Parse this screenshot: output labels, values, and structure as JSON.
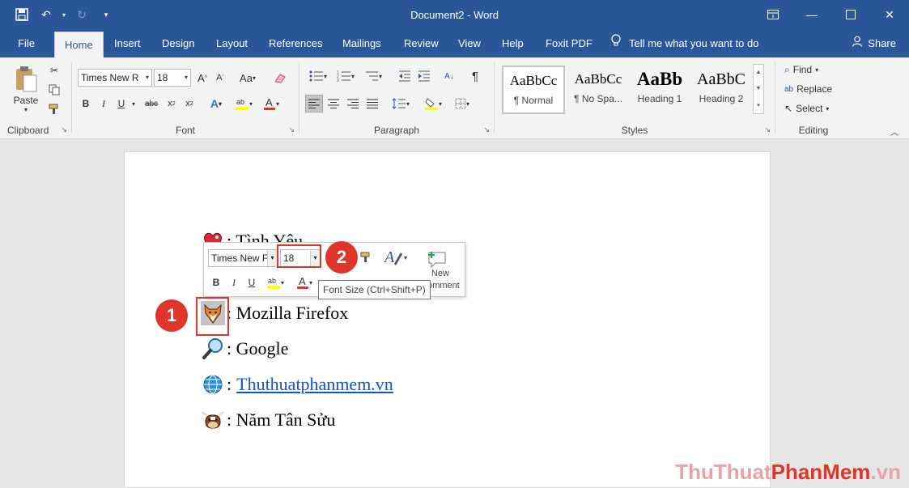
{
  "window": {
    "title": "Document2  -  Word"
  },
  "tabs": [
    {
      "label": "File"
    },
    {
      "label": "Home"
    },
    {
      "label": "Insert"
    },
    {
      "label": "Design"
    },
    {
      "label": "Layout"
    },
    {
      "label": "References"
    },
    {
      "label": "Mailings"
    },
    {
      "label": "Review"
    },
    {
      "label": "View"
    },
    {
      "label": "Help"
    },
    {
      "label": "Foxit PDF"
    }
  ],
  "tell_me": "Tell me what you want to do",
  "share_label": "Share",
  "ribbon": {
    "clipboard": {
      "paste_label": "Paste",
      "group_label": "Clipboard"
    },
    "font": {
      "font_name": "Times New R",
      "font_size": "18",
      "group_label": "Font",
      "case_label": "Aa"
    },
    "paragraph": {
      "group_label": "Paragraph"
    },
    "styles": {
      "group_label": "Styles",
      "items": [
        {
          "preview": "AaBbCc",
          "name": "¶ Normal"
        },
        {
          "preview": "AaBbCc",
          "name": "¶ No Spa..."
        },
        {
          "preview": "AaBb",
          "name": "Heading 1"
        },
        {
          "preview": "AaBbC",
          "name": "Heading 2"
        }
      ]
    },
    "editing": {
      "find_label": "Find",
      "replace_label": "Replace",
      "select_label": "Select",
      "group_label": "Editing"
    }
  },
  "document": {
    "lines": [
      {
        "emoji": "heart-icon",
        "text": ": Tình Yêu"
      },
      {
        "emoji": "firefox-icon",
        "text": ": Mozilla Firefox"
      },
      {
        "emoji": "magnifier-icon",
        "text": ": Google"
      },
      {
        "emoji": "globe-icon",
        "text": "Thuthuatphanmem.vn",
        "prefix": ":"
      },
      {
        "emoji": "ox-icon",
        "text": ": Năm Tân Sửu"
      }
    ]
  },
  "minibar": {
    "font_name": "Times New F",
    "font_size": "18",
    "new_comment_label": "New",
    "new_comment_label2": "Comment"
  },
  "tooltip": "Font Size (Ctrl+Shift+P)",
  "badges": [
    "1",
    "2"
  ],
  "watermark": {
    "part1": "ThuThuat",
    "part2": "PhanMem",
    "part3": ".vn"
  },
  "colors": {
    "word_blue": "#2b579a",
    "highlight_red": "#e0352b",
    "link_blue": "#1155cc"
  }
}
